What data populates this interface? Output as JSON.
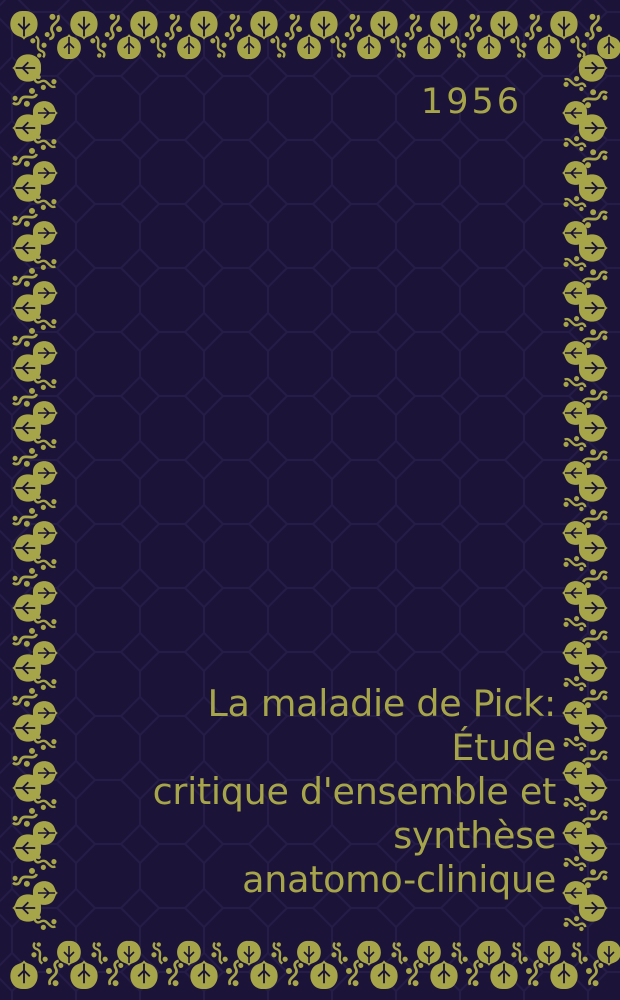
{
  "cover": {
    "year": "1956",
    "title_lines": [
      "La maladie de Pick:",
      "Étude",
      "critique d'ensemble et",
      "synthèse",
      "anatomo-clinique"
    ],
    "colors": {
      "background": "#1b1338",
      "pattern_line": "#251c47",
      "ornament": "#a7a54a",
      "text": "#a7a54a"
    },
    "ornament": "floral-vine-border"
  }
}
